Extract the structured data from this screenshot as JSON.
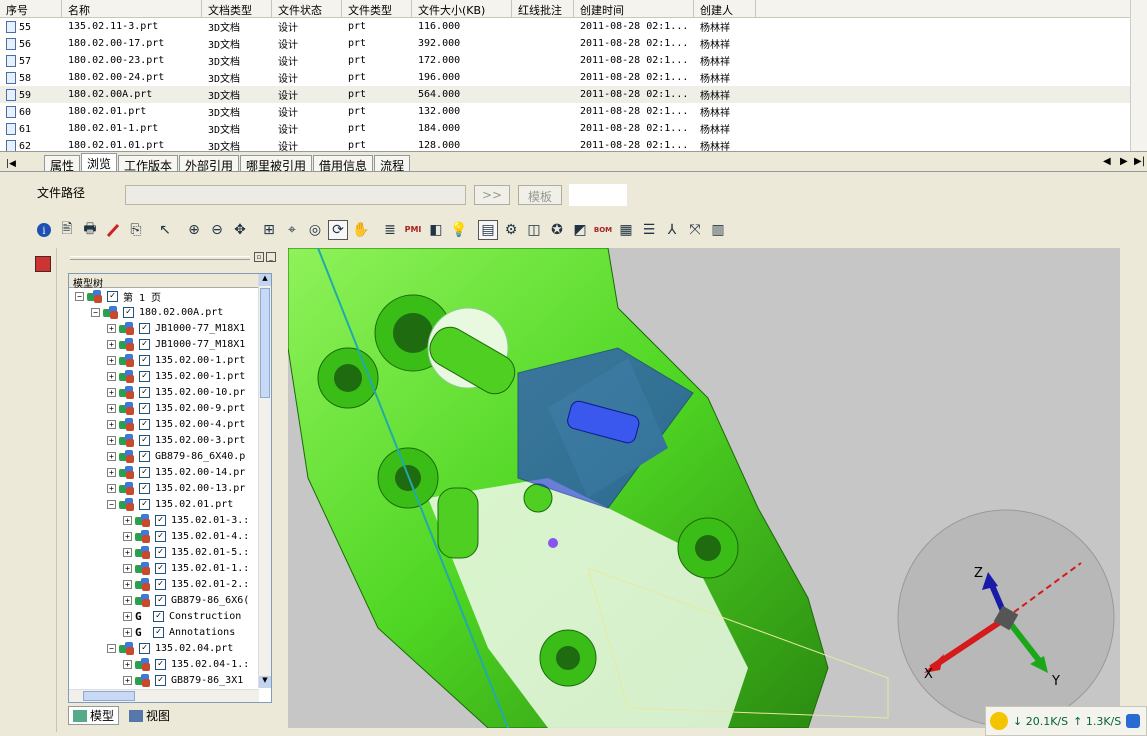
{
  "grid": {
    "columns": [
      "序号",
      "名称",
      "文档类型",
      "文件状态",
      "文件类型",
      "文件大小(KB)",
      "红线批注",
      "创建时间",
      "创建人"
    ],
    "rows": [
      [
        "55",
        "135.02.11-3.prt",
        "3D文档",
        "设计",
        "prt",
        "116.000",
        "",
        "2011-08-28 02:1...",
        "杨林祥"
      ],
      [
        "56",
        "180.02.00-17.prt",
        "3D文档",
        "设计",
        "prt",
        "392.000",
        "",
        "2011-08-28 02:1...",
        "杨林祥"
      ],
      [
        "57",
        "180.02.00-23.prt",
        "3D文档",
        "设计",
        "prt",
        "172.000",
        "",
        "2011-08-28 02:1...",
        "杨林祥"
      ],
      [
        "58",
        "180.02.00-24.prt",
        "3D文档",
        "设计",
        "prt",
        "196.000",
        "",
        "2011-08-28 02:1...",
        "杨林祥"
      ],
      [
        "59",
        "180.02.00A.prt",
        "3D文档",
        "设计",
        "prt",
        "564.000",
        "",
        "2011-08-28 02:1...",
        "杨林祥"
      ],
      [
        "60",
        "180.02.01.prt",
        "3D文档",
        "设计",
        "prt",
        "132.000",
        "",
        "2011-08-28 02:1...",
        "杨林祥"
      ],
      [
        "61",
        "180.02.01-1.prt",
        "3D文档",
        "设计",
        "prt",
        "184.000",
        "",
        "2011-08-28 02:1...",
        "杨林祥"
      ],
      [
        "62",
        "180.02.01.01.prt",
        "3D文档",
        "设计",
        "prt",
        "128.000",
        "",
        "2011-08-28 02:1...",
        "杨林祥"
      ]
    ]
  },
  "tabs": [
    "属性",
    "浏览",
    "工作版本",
    "外部引用",
    "哪里被引用",
    "借用信息",
    "流程"
  ],
  "path": {
    "label": "文件路径",
    "go_label": ">>",
    "template_label": "模板"
  },
  "tree": {
    "header": "模型树",
    "nodes": [
      {
        "text": "第 1 页",
        "level": 0,
        "expander": "−",
        "icon": "model"
      },
      {
        "text": "180.02.00A.prt",
        "level": 1,
        "expander": "−",
        "icon": "model"
      },
      {
        "text": "JB1000-77_M18X1",
        "level": 2,
        "expander": "+",
        "icon": "model"
      },
      {
        "text": "JB1000-77_M18X1",
        "level": 2,
        "expander": "+",
        "icon": "model"
      },
      {
        "text": "135.02.00-1.prt",
        "level": 2,
        "expander": "+",
        "icon": "model"
      },
      {
        "text": "135.02.00-1.prt",
        "level": 2,
        "expander": "+",
        "icon": "model"
      },
      {
        "text": "135.02.00-10.pr",
        "level": 2,
        "expander": "+",
        "icon": "model"
      },
      {
        "text": "135.02.00-9.prt",
        "level": 2,
        "expander": "+",
        "icon": "model"
      },
      {
        "text": "135.02.00-4.prt",
        "level": 2,
        "expander": "+",
        "icon": "model"
      },
      {
        "text": "135.02.00-3.prt",
        "level": 2,
        "expander": "+",
        "icon": "model"
      },
      {
        "text": "GB879-86_6X40.p",
        "level": 2,
        "expander": "+",
        "icon": "model"
      },
      {
        "text": "135.02.00-14.pr",
        "level": 2,
        "expander": "+",
        "icon": "model"
      },
      {
        "text": "135.02.00-13.pr",
        "level": 2,
        "expander": "+",
        "icon": "model"
      },
      {
        "text": "135.02.01.prt",
        "level": 2,
        "expander": "−",
        "icon": "model"
      },
      {
        "text": "135.02.01-3.:",
        "level": 3,
        "expander": "+",
        "icon": "model"
      },
      {
        "text": "135.02.01-4.:",
        "level": 3,
        "expander": "+",
        "icon": "model"
      },
      {
        "text": "135.02.01-5.:",
        "level": 3,
        "expander": "+",
        "icon": "model"
      },
      {
        "text": "135.02.01-1.:",
        "level": 3,
        "expander": "+",
        "icon": "model"
      },
      {
        "text": "135.02.01-2.:",
        "level": 3,
        "expander": "+",
        "icon": "model"
      },
      {
        "text": "GB879-86_6X6(",
        "level": 3,
        "expander": "+",
        "icon": "model"
      },
      {
        "text": "Construction",
        "level": 3,
        "expander": "+",
        "icon": "G"
      },
      {
        "text": "Annotations",
        "level": 3,
        "expander": "+",
        "icon": "G"
      },
      {
        "text": "135.02.04.prt",
        "level": 2,
        "expander": "−",
        "icon": "model"
      },
      {
        "text": "135.02.04-1.:",
        "level": 3,
        "expander": "+",
        "icon": "model"
      },
      {
        "text": "GB879-86_3X1",
        "level": 3,
        "expander": "+",
        "icon": "model"
      }
    ],
    "bottom_tabs": [
      "模型",
      "视图"
    ]
  },
  "axes": {
    "x": "X",
    "y": "Y",
    "z": "Z"
  },
  "status": {
    "down": "↓ 20.1K/S",
    "up": "↑ 1.3K/S"
  }
}
